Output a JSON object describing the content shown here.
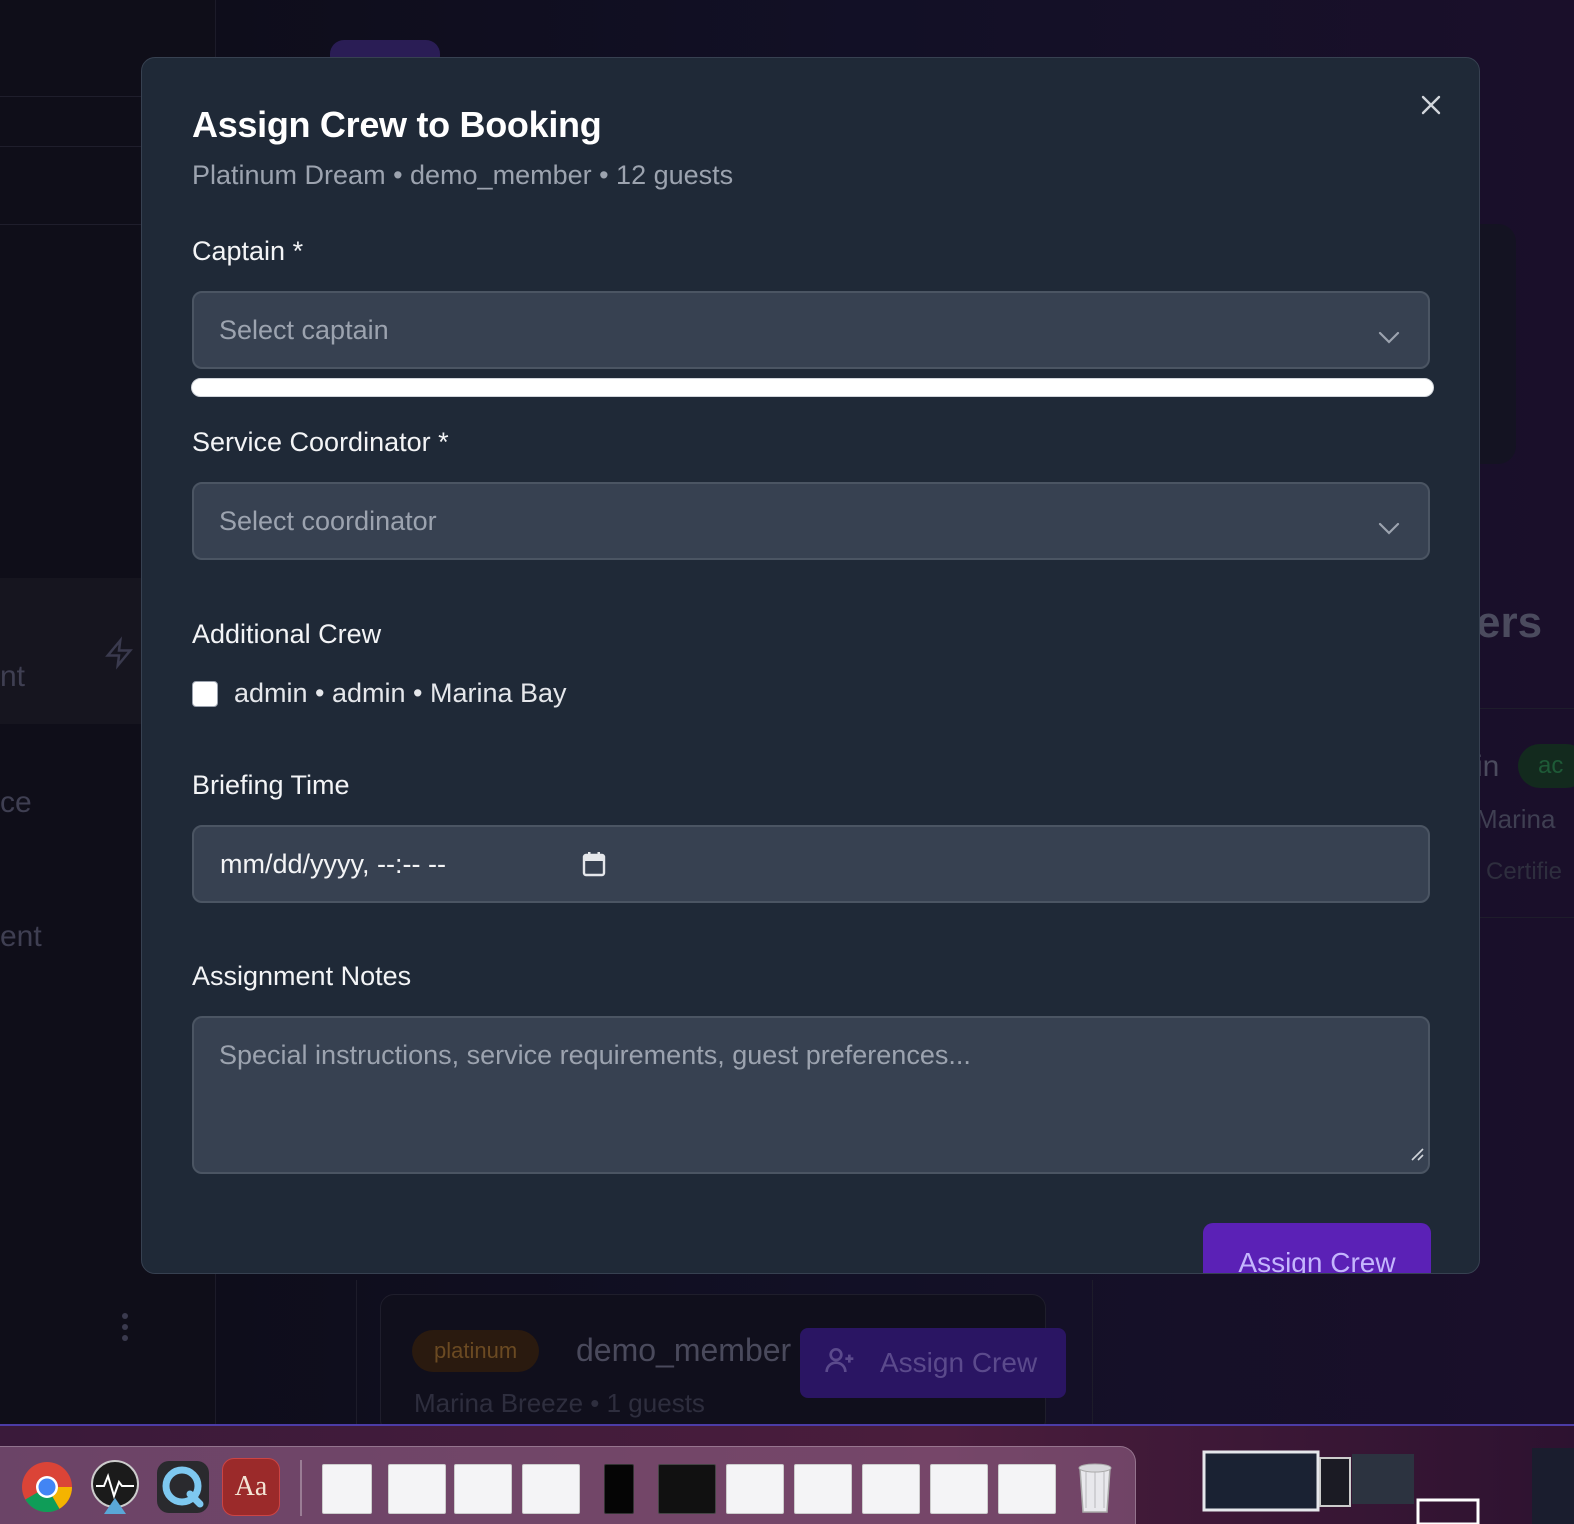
{
  "modal": {
    "title": "Assign Crew to Booking",
    "subtitle": "Platinum Dream • demo_member • 12 guests",
    "close_icon": "x-icon",
    "captain": {
      "label": "Captain *",
      "placeholder": "Select captain"
    },
    "coordinator": {
      "label": "Service Coordinator *",
      "placeholder": "Select coordinator"
    },
    "additional_crew": {
      "label": "Additional Crew",
      "options": [
        {
          "text": "admin • admin • Marina Bay",
          "checked": false
        }
      ]
    },
    "briefing_time": {
      "label": "Briefing Time",
      "value": "mm/dd/yyyy, --:-- --"
    },
    "notes": {
      "label": "Assignment Notes",
      "placeholder": "Special instructions, service requirements, guest preferences..."
    },
    "submit_label": "Assign Crew"
  },
  "background": {
    "sidebar_fragments": [
      "nt",
      "ce",
      "ent"
    ],
    "right_fragments": [
      "ers",
      "in",
      "ac",
      "Marina",
      "Certifie"
    ],
    "booking_card": {
      "badge": "platinum",
      "member": "demo_member",
      "sub": "Marina Breeze • 1 guests",
      "button": "Assign Crew"
    }
  },
  "dock": {
    "apps": [
      "chrome-icon",
      "instruments-icon",
      "quicktime-icon",
      "dictionary-icon"
    ],
    "dictionary_label": "Aa"
  }
}
